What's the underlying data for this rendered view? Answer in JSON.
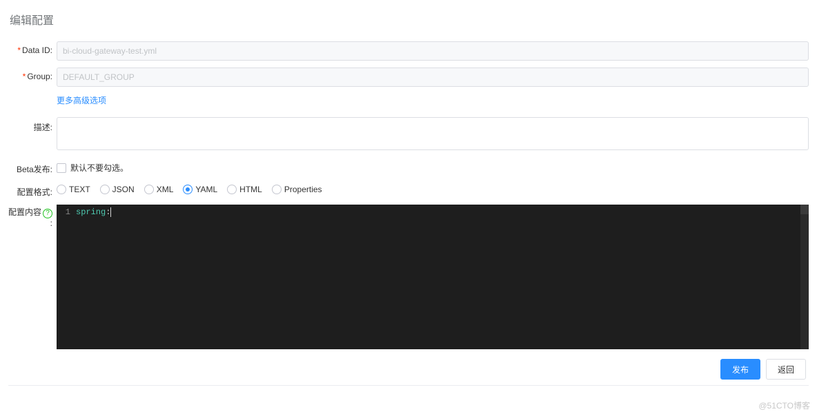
{
  "page": {
    "title": "编辑配置"
  },
  "form": {
    "data_id": {
      "label": "Data ID:",
      "value": "bi-cloud-gateway-test.yml"
    },
    "group": {
      "label": "Group:",
      "value": "DEFAULT_GROUP"
    },
    "advanced_link": "更多高级选项",
    "desc": {
      "label": "描述:",
      "value": ""
    },
    "beta": {
      "label": "Beta发布:",
      "check_label": "默认不要勾选。"
    },
    "format": {
      "label": "配置格式:",
      "options": [
        "TEXT",
        "JSON",
        "XML",
        "YAML",
        "HTML",
        "Properties"
      ],
      "selected": "YAML"
    },
    "content": {
      "label": "配置内容"
    }
  },
  "editor": {
    "line_no": "1",
    "code_kw": "spring",
    "code_sep": ":"
  },
  "buttons": {
    "publish": "发布",
    "back": "返回"
  },
  "watermark": "@51CTO博客"
}
